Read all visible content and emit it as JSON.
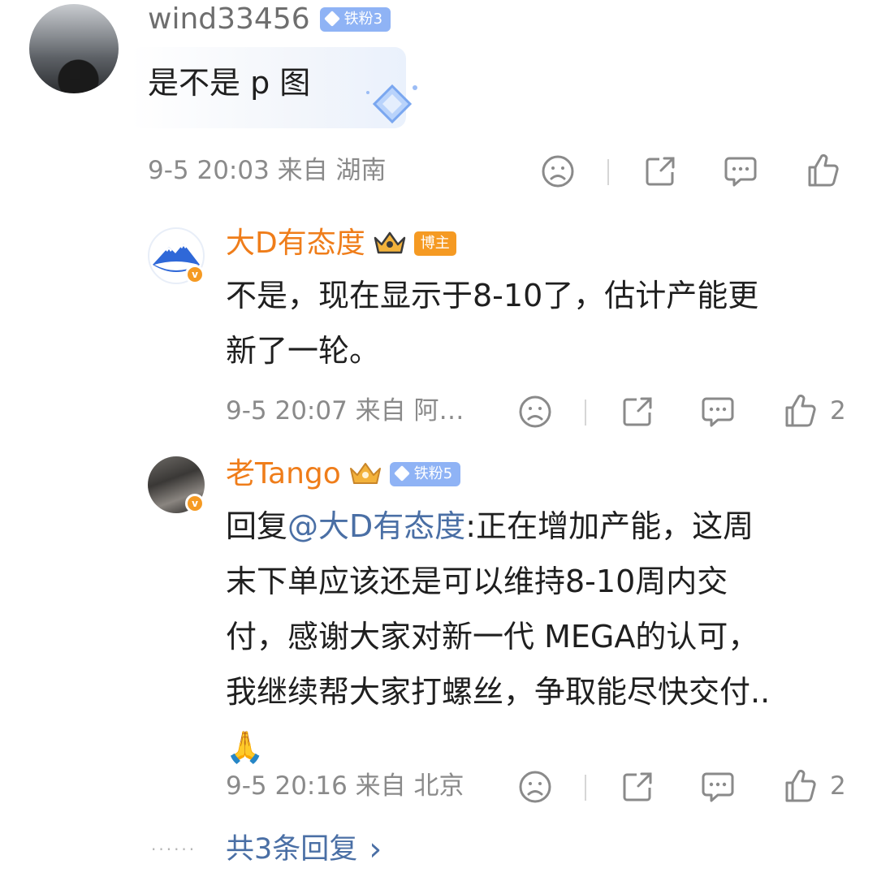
{
  "main_comment": {
    "username": "wind33456",
    "badge": "铁粉3",
    "text": "是不是 p 图",
    "time_location": "9-5 20:03 来自 湖南",
    "actions": [
      "sad-face-icon",
      "share-icon",
      "comment-icon",
      "like-icon"
    ]
  },
  "replies": [
    {
      "username": "大D有态度",
      "badge": "博主",
      "text_line1": "不是，现在显示于8-10了，估计产能更",
      "text_line2": "新了一轮。",
      "time_location": "9-5 20:07 来自 阿…",
      "like_count": "2"
    },
    {
      "username": "老Tango",
      "badge": "铁粉5",
      "reply_prefix": "回复",
      "mention": "@大D有态度",
      "text_line1_rest": ":正在增加产能，这周",
      "text_line2": "末下单应该还是可以维持8-10周内交",
      "text_line3": "付，感谢大家对新一代 MEGA的认可，",
      "text_line4": "我继续帮大家打螺丝，争取能尽快交付..",
      "emoji": "🙏",
      "time_location": "9-5 20:16 来自 北京",
      "like_count": "2"
    }
  ],
  "more_replies": {
    "dots": "······",
    "label": "共3条回复",
    "chevron": "›"
  },
  "colors": {
    "accent_orange": "#ef7d1a",
    "mention_blue": "#4a6fa5",
    "fan_badge": "#8fb3f5",
    "meta_gray": "#8a8a8a"
  }
}
